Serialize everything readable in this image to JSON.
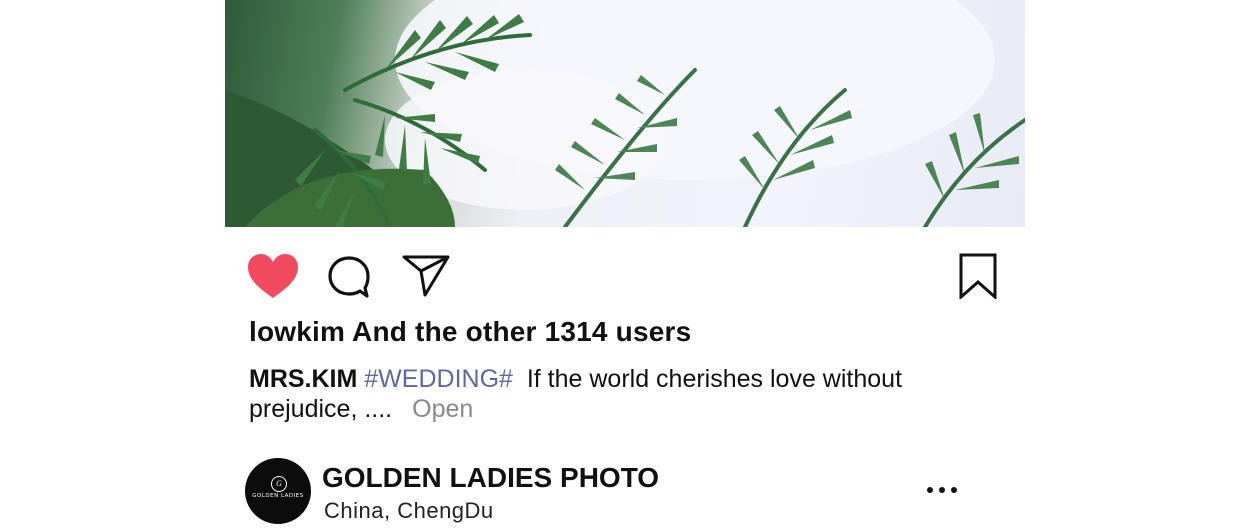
{
  "post": {
    "image_alt": "wedding photo with white gown and palm leaves",
    "likes_text": "lowkim And the other 1314 users"
  },
  "caption": {
    "username": "MRS.KIM",
    "hashtag": "#WEDDING#",
    "text": "If the world cherishes love without prejudice, ....",
    "open_label": "Open"
  },
  "account": {
    "name": "GOLDEN LADIES PHOTO",
    "location": "China, ChengDu",
    "avatar_monogram": "G",
    "avatar_brand": "GOLDEN LADIES"
  },
  "icons": {
    "like": "heart-icon",
    "comment": "comment-icon",
    "share": "send-icon",
    "save": "bookmark-icon",
    "more": "more-icon"
  },
  "colors": {
    "like": "#f24a5e",
    "hashtag": "#5d6aa1",
    "open": "#8a8a8a"
  }
}
